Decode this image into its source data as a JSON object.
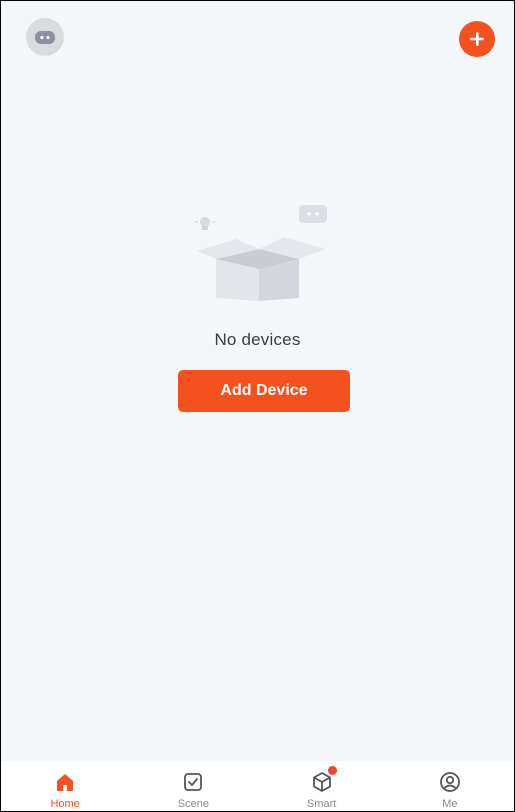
{
  "header": {
    "avatar_icon": "robot-avatar-icon",
    "add_icon": "plus-circle-icon"
  },
  "empty_state": {
    "illustration": "empty-box-illustration",
    "message": "No devices",
    "button_label": "Add Device"
  },
  "tabbar": {
    "tabs": [
      {
        "label": "Home",
        "icon": "home-icon",
        "active": true
      },
      {
        "label": "Scene",
        "icon": "checkbox-icon",
        "active": false
      },
      {
        "label": "Smart",
        "icon": "cube-icon",
        "active": false,
        "badge": true
      },
      {
        "label": "Me",
        "icon": "user-circle-icon",
        "active": false
      }
    ]
  },
  "colors": {
    "accent": "#f4511e",
    "background": "#f4f7fa",
    "badge": "#f44336"
  }
}
